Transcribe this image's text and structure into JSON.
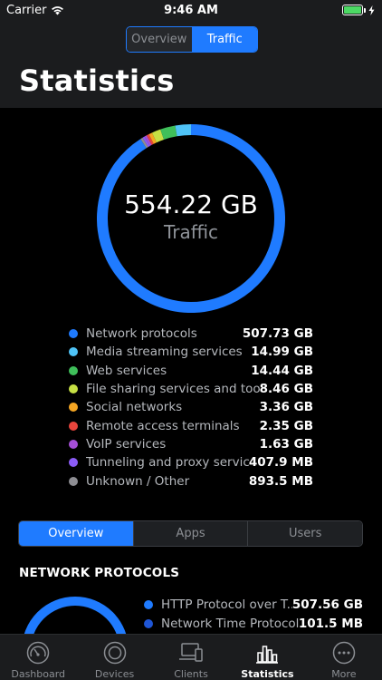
{
  "status": {
    "carrier": "Carrier",
    "time": "9:46 AM"
  },
  "top_segment": [
    {
      "label": "Overview",
      "active": false
    },
    {
      "label": "Traffic",
      "active": true
    }
  ],
  "page_title": "Statistics",
  "traffic": {
    "total": "554.22 GB",
    "label": "Traffic"
  },
  "chart_data": {
    "type": "pie",
    "title": "",
    "categories": [
      "Network protocols",
      "Media streaming services",
      "Web services",
      "File sharing services and tools",
      "Social networks",
      "Remote access terminals",
      "VoIP services",
      "Tunneling and proxy services",
      "Unknown / Other"
    ],
    "values": [
      507.73,
      14.99,
      14.44,
      8.46,
      3.36,
      2.35,
      1.63,
      0.4079,
      0.8935
    ],
    "units": "GB",
    "colors": [
      "#1f7bff",
      "#4fc3f7",
      "#3fbf5a",
      "#c6e044",
      "#f5a623",
      "#e8453c",
      "#a64fd8",
      "#8b5cf6",
      "#8e8e93"
    ],
    "value_labels": [
      "507.73 GB",
      "14.99 GB",
      "14.44 GB",
      "8.46 GB",
      "3.36 GB",
      "2.35 GB",
      "1.63 GB",
      "407.9 MB",
      "893.5 MB"
    ]
  },
  "bottom_segment": [
    {
      "label": "Overview",
      "active": true
    },
    {
      "label": "Apps",
      "active": false
    },
    {
      "label": "Users",
      "active": false
    }
  ],
  "section_title": "NETWORK PROTOCOLS",
  "network_protocols": [
    {
      "label": "HTTP Protocol over T...",
      "value": "507.56 GB",
      "color": "#1f7bff"
    },
    {
      "label": "Network Time Protocol",
      "value": "101.5 MB",
      "color": "#1f56d6"
    }
  ],
  "tabs": [
    {
      "label": "Dashboard",
      "icon": "speedometer-icon",
      "active": false
    },
    {
      "label": "Devices",
      "icon": "target-icon",
      "active": false
    },
    {
      "label": "Clients",
      "icon": "devices-icon",
      "active": false
    },
    {
      "label": "Statistics",
      "icon": "bar-chart-icon",
      "active": true
    },
    {
      "label": "More",
      "icon": "ellipsis-icon",
      "active": false
    }
  ]
}
